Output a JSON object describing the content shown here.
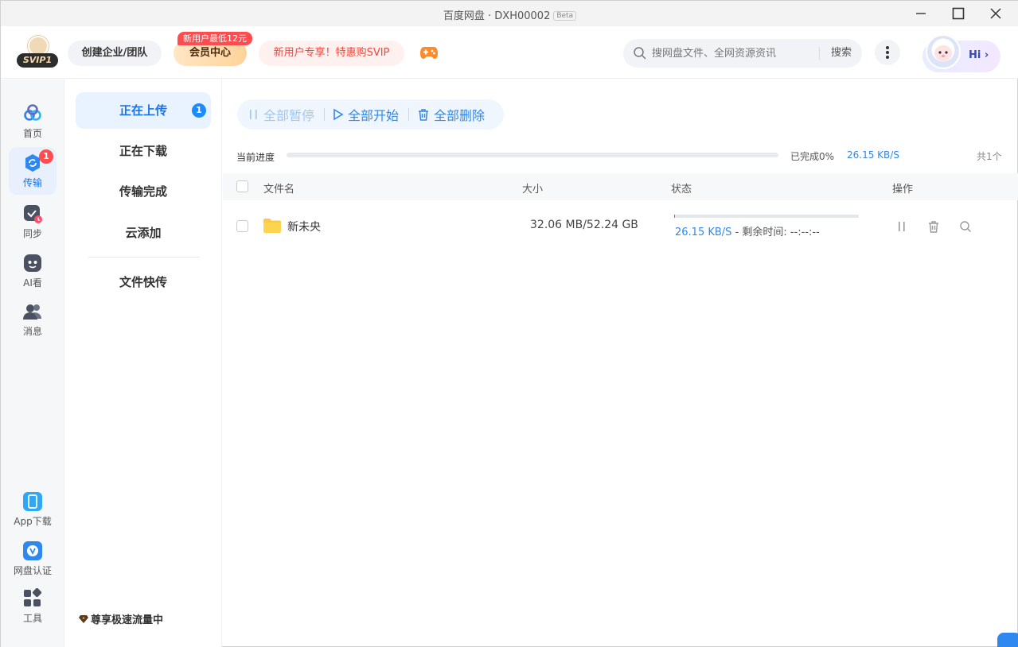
{
  "window": {
    "title": "百度网盘 · DXH00002",
    "beta": "Beta"
  },
  "header": {
    "svip_badge": "SVIP1",
    "create_team": "创建企业/团队",
    "vip_center": "会员中心",
    "vip_promo_tag": "新用户最低12元",
    "promo": "新用户专享！特惠购SVIP",
    "search": {
      "placeholder": "搜网盘文件、全网资源资讯",
      "button": "搜索"
    },
    "greeting": "Hi"
  },
  "rail": {
    "items": [
      {
        "label": "首页",
        "icon": "home-icon"
      },
      {
        "label": "传输",
        "icon": "transfer-icon",
        "badge": "1",
        "active": true
      },
      {
        "label": "同步",
        "icon": "sync-icon"
      },
      {
        "label": "AI看",
        "icon": "ai-icon"
      },
      {
        "label": "消息",
        "icon": "message-icon"
      }
    ],
    "bottom": [
      {
        "label": "App下载",
        "icon": "phone-icon"
      },
      {
        "label": "网盘认证",
        "icon": "verify-icon"
      },
      {
        "label": "工具",
        "icon": "tools-icon"
      }
    ]
  },
  "subnav": {
    "items": [
      {
        "label": "正在上传",
        "badge": "1",
        "active": true
      },
      {
        "label": "正在下载"
      },
      {
        "label": "传输完成"
      },
      {
        "label": "云添加"
      },
      {
        "label": "文件快传"
      }
    ],
    "footer": "尊享极速流量中"
  },
  "toolbar": {
    "pause_all": "全部暂停",
    "start_all": "全部开始",
    "delete_all": "全部删除"
  },
  "progress": {
    "label": "当前进度",
    "percent": 0,
    "done": "已完成0%",
    "speed": "26.15 KB/S",
    "total": "共1个"
  },
  "table": {
    "columns": {
      "name": "文件名",
      "size": "大小",
      "status": "状态",
      "actions": "操作"
    },
    "rows": [
      {
        "name": "新未央",
        "size": "32.06 MB/52.24 GB",
        "progress": 0.06,
        "speed": "26.15 KB/S",
        "remaining": " - 剩余时间: --:--:--"
      }
    ]
  },
  "colors": {
    "accent": "#2e88f0",
    "badge_red": "#ff4d4f",
    "promo": "#f5463b"
  }
}
